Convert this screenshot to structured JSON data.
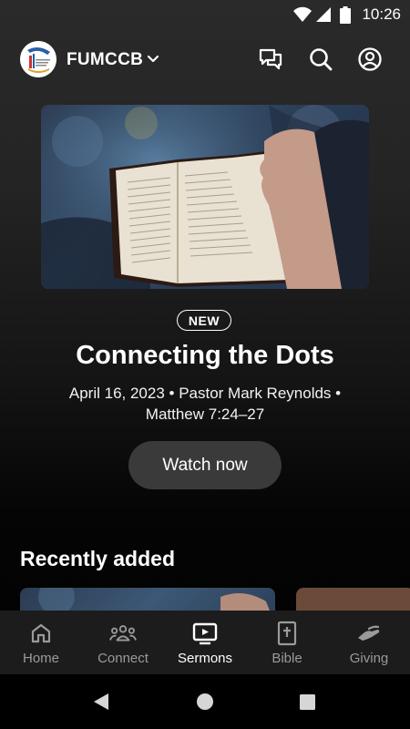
{
  "status_bar": {
    "time": "10:26"
  },
  "header": {
    "org_name": "FUMCCB"
  },
  "hero": {
    "badge": "NEW",
    "title": "Connecting the Dots",
    "meta_line1": "April 16, 2023 • Pastor Mark Reynolds •",
    "meta_line2": "Matthew 7:24–27",
    "watch_label": "Watch now"
  },
  "recent": {
    "title": "Recently added"
  },
  "nav": {
    "items": [
      {
        "label": "Home",
        "icon": "home-icon"
      },
      {
        "label": "Connect",
        "icon": "group-icon"
      },
      {
        "label": "Sermons",
        "icon": "video-icon",
        "active": true
      },
      {
        "label": "Bible",
        "icon": "bible-icon"
      },
      {
        "label": "Giving",
        "icon": "hand-icon"
      }
    ]
  },
  "colors": {
    "background": "#111111",
    "nav_bg": "#1c1c1c",
    "button_bg": "#3a3a3a",
    "inactive": "#9a9a9a"
  }
}
